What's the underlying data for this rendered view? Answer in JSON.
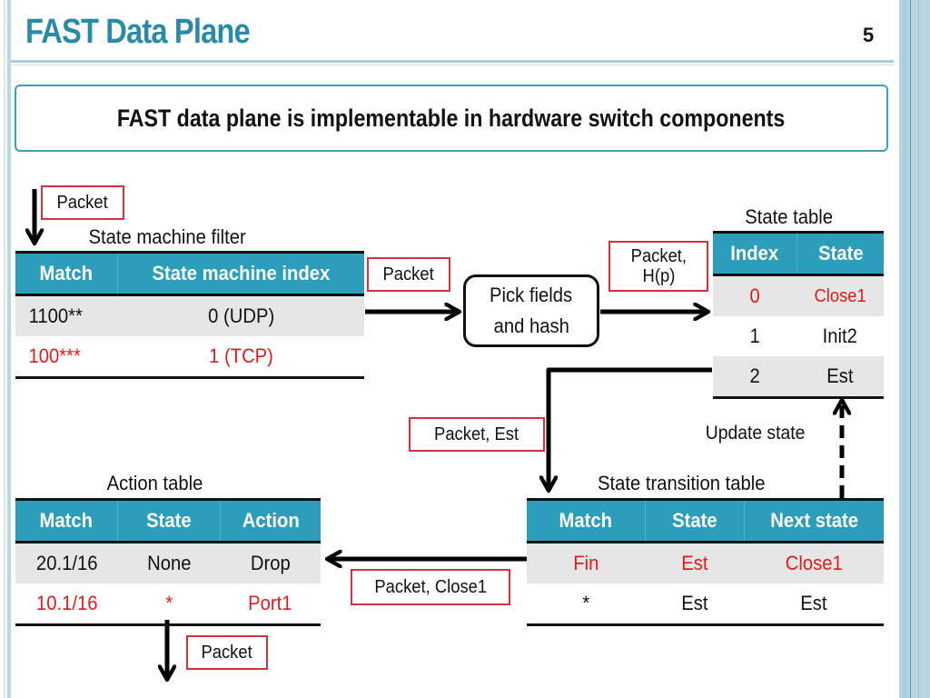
{
  "slide": {
    "title": "FAST Data Plane",
    "page_number": "5",
    "headline": "FAST data plane is implementable in hardware switch components"
  },
  "labels": {
    "packet_in": "Packet",
    "packet_to_hash": "Packet",
    "packet_hash": "Packet,\nH(p)",
    "packet_hash_line1": "Packet,",
    "packet_hash_line2": "H(p)",
    "packet_est": "Packet, Est",
    "update_state": "Update state",
    "packet_close1": "Packet, Close1",
    "packet_out": "Packet"
  },
  "process": {
    "line1": "Pick fields",
    "line2": "and hash"
  },
  "state_machine_filter": {
    "caption": "State machine filter",
    "headers": [
      "Match",
      "State machine index"
    ],
    "rows": [
      {
        "cells": [
          "1100**",
          "0 (UDP)"
        ],
        "highlight": false
      },
      {
        "cells": [
          "100***",
          "1 (TCP)"
        ],
        "highlight": true
      }
    ]
  },
  "state_table": {
    "caption": "State table",
    "headers": [
      "Index",
      "State"
    ],
    "rows": [
      {
        "cells": [
          "0",
          "Close1"
        ],
        "highlight": true
      },
      {
        "cells": [
          "1",
          "Init2"
        ],
        "highlight": false
      },
      {
        "cells": [
          "2",
          "Est"
        ],
        "highlight": false
      }
    ]
  },
  "state_transition_table": {
    "caption": "State transition table",
    "headers": [
      "Match",
      "State",
      "Next state"
    ],
    "rows": [
      {
        "cells": [
          "Fin",
          "Est",
          "Close1"
        ],
        "highlight": true
      },
      {
        "cells": [
          "*",
          "Est",
          "Est"
        ],
        "highlight": false
      }
    ]
  },
  "action_table": {
    "caption": "Action table",
    "headers": [
      "Match",
      "State",
      "Action"
    ],
    "rows": [
      {
        "cells": [
          "20.1/16",
          "None",
          "Drop"
        ],
        "highlight": false
      },
      {
        "cells": [
          "10.1/16",
          "*",
          "Port1"
        ],
        "highlight": true
      }
    ]
  },
  "colors": {
    "title": "#2a8ba8",
    "table_header": "#2c9dbb",
    "highlight_text": "#e01b1b",
    "label_border": "#d1333d"
  }
}
